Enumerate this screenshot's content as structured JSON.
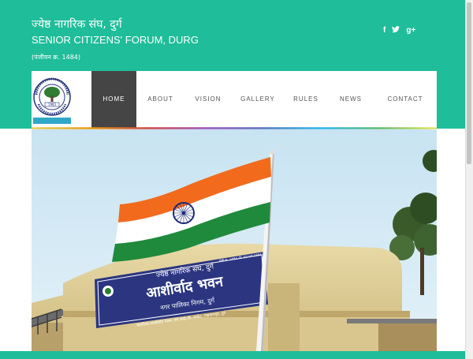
{
  "header": {
    "title_hindi": "ज्येष्ठ नागरिक संघ, दुर्ग",
    "title_english": "SENIOR CITIZENS' FORUM, DURG",
    "registration": "(पंजीयन क्र. 1484)"
  },
  "social": {
    "facebook": "f",
    "twitter": "🐦",
    "googleplus": "g+"
  },
  "nav": {
    "items": [
      {
        "label": "HOME"
      },
      {
        "label": "ABOUT"
      },
      {
        "label": "VISION"
      },
      {
        "label": "GALLERY"
      },
      {
        "label": "RULES"
      },
      {
        "label": "NEWS"
      },
      {
        "label": "CONTACT"
      }
    ]
  },
  "logo": {
    "year": "1983",
    "ring_text": "ज्येष्ठ नागरिक संघ दुर्ग"
  },
  "hero": {
    "board_top": "ज्येष्ठ नागरिक संघ, दुर्ग",
    "board_main": "आशीर्वाद भवन",
    "board_sub": "नगर पालिका निगम, दुर्ग",
    "board_address": "कार्यालय-आशीर्वाद भवन, एम.आई.जी. मार्केट, पद्मनाभपुर, दुर्ग",
    "board_reg": "पंजी.क्र. 1484, दि. 02.04.1983"
  },
  "colors": {
    "brand": "#1fbd99",
    "nav_active": "#454545",
    "saffron": "#f26b1d",
    "green": "#1f8a3b",
    "chakra": "#1c2a7a"
  }
}
